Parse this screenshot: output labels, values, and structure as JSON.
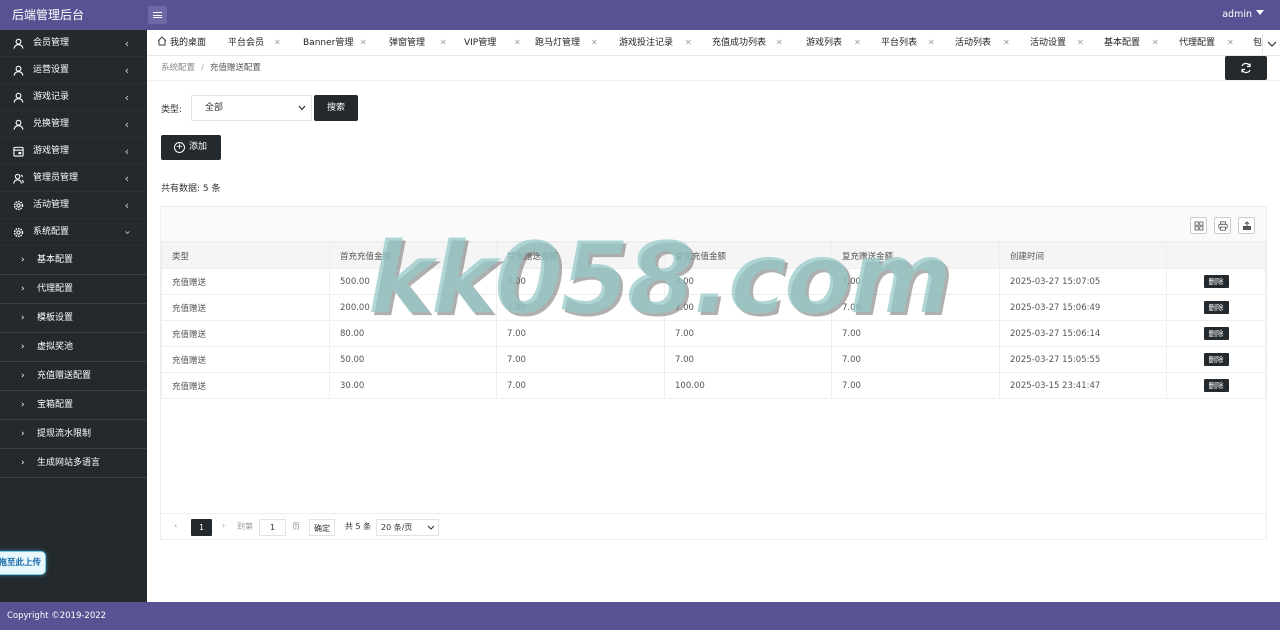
{
  "header": {
    "logo": "后端管理后台",
    "user": "admin"
  },
  "sidebar": {
    "groups": [
      {
        "label": "会员管理",
        "icon": "user-icon"
      },
      {
        "label": "运营设置",
        "icon": "user-icon"
      },
      {
        "label": "游戏记录",
        "icon": "user-icon"
      },
      {
        "label": "兑换管理",
        "icon": "user-icon"
      },
      {
        "label": "游戏管理",
        "icon": "calendar-icon"
      },
      {
        "label": "管理员管理",
        "icon": "users-icon"
      },
      {
        "label": "活动管理",
        "icon": "gear-icon"
      },
      {
        "label": "系统配置",
        "icon": "gear-icon"
      }
    ],
    "sub_items": [
      "基本配置",
      "代理配置",
      "模板设置",
      "虚拟奖池",
      "充值赠送配置",
      "宝箱配置",
      "提现流水限制",
      "生成网站多语言"
    ],
    "upload": "拖至此上传"
  },
  "tabs": [
    "我的桌面",
    "平台会员",
    "Banner管理",
    "弹窗管理",
    "VIP管理",
    "跑马灯管理",
    "游戏投注记录",
    "充值成功列表",
    "游戏列表",
    "平台列表",
    "活动列表",
    "活动设置",
    "基本配置",
    "代理配置",
    "包"
  ],
  "breadcrumb": {
    "parent": "系统配置",
    "separator": "/",
    "current": "充值赠送配置"
  },
  "filter": {
    "label": "类型:",
    "selected": "全部",
    "search_label": "搜索"
  },
  "add_label": "添加",
  "count_text": "共有数据: 5 条",
  "table": {
    "headers": [
      "类型",
      "首充充值金额",
      "首充赠送金额",
      "复充充值金额",
      "复充赠送金额",
      "创建时间",
      ""
    ],
    "rows": [
      [
        "充值赠送",
        "500.00",
        "7.00",
        "7.00",
        "7.00",
        "2025-03-27 15:07:05"
      ],
      [
        "充值赠送",
        "200.00",
        "7.00",
        "7.00",
        "7.00",
        "2025-03-27 15:06:49"
      ],
      [
        "充值赠送",
        "80.00",
        "7.00",
        "7.00",
        "7.00",
        "2025-03-27 15:06:14"
      ],
      [
        "充值赠送",
        "50.00",
        "7.00",
        "7.00",
        "7.00",
        "2025-03-27 15:05:55"
      ],
      [
        "充值赠送",
        "30.00",
        "7.00",
        "100.00",
        "7.00",
        "2025-03-15 23:41:47"
      ]
    ],
    "delete_label": "删除"
  },
  "pager": {
    "current": "1",
    "goto_label": "到第",
    "page_value": "1",
    "page_unit": "页",
    "confirm": "确定",
    "total": "共 5 条",
    "page_size": "20 条/页"
  },
  "watermark": "kk058.com",
  "footer": "Copyright ©2019-2022"
}
